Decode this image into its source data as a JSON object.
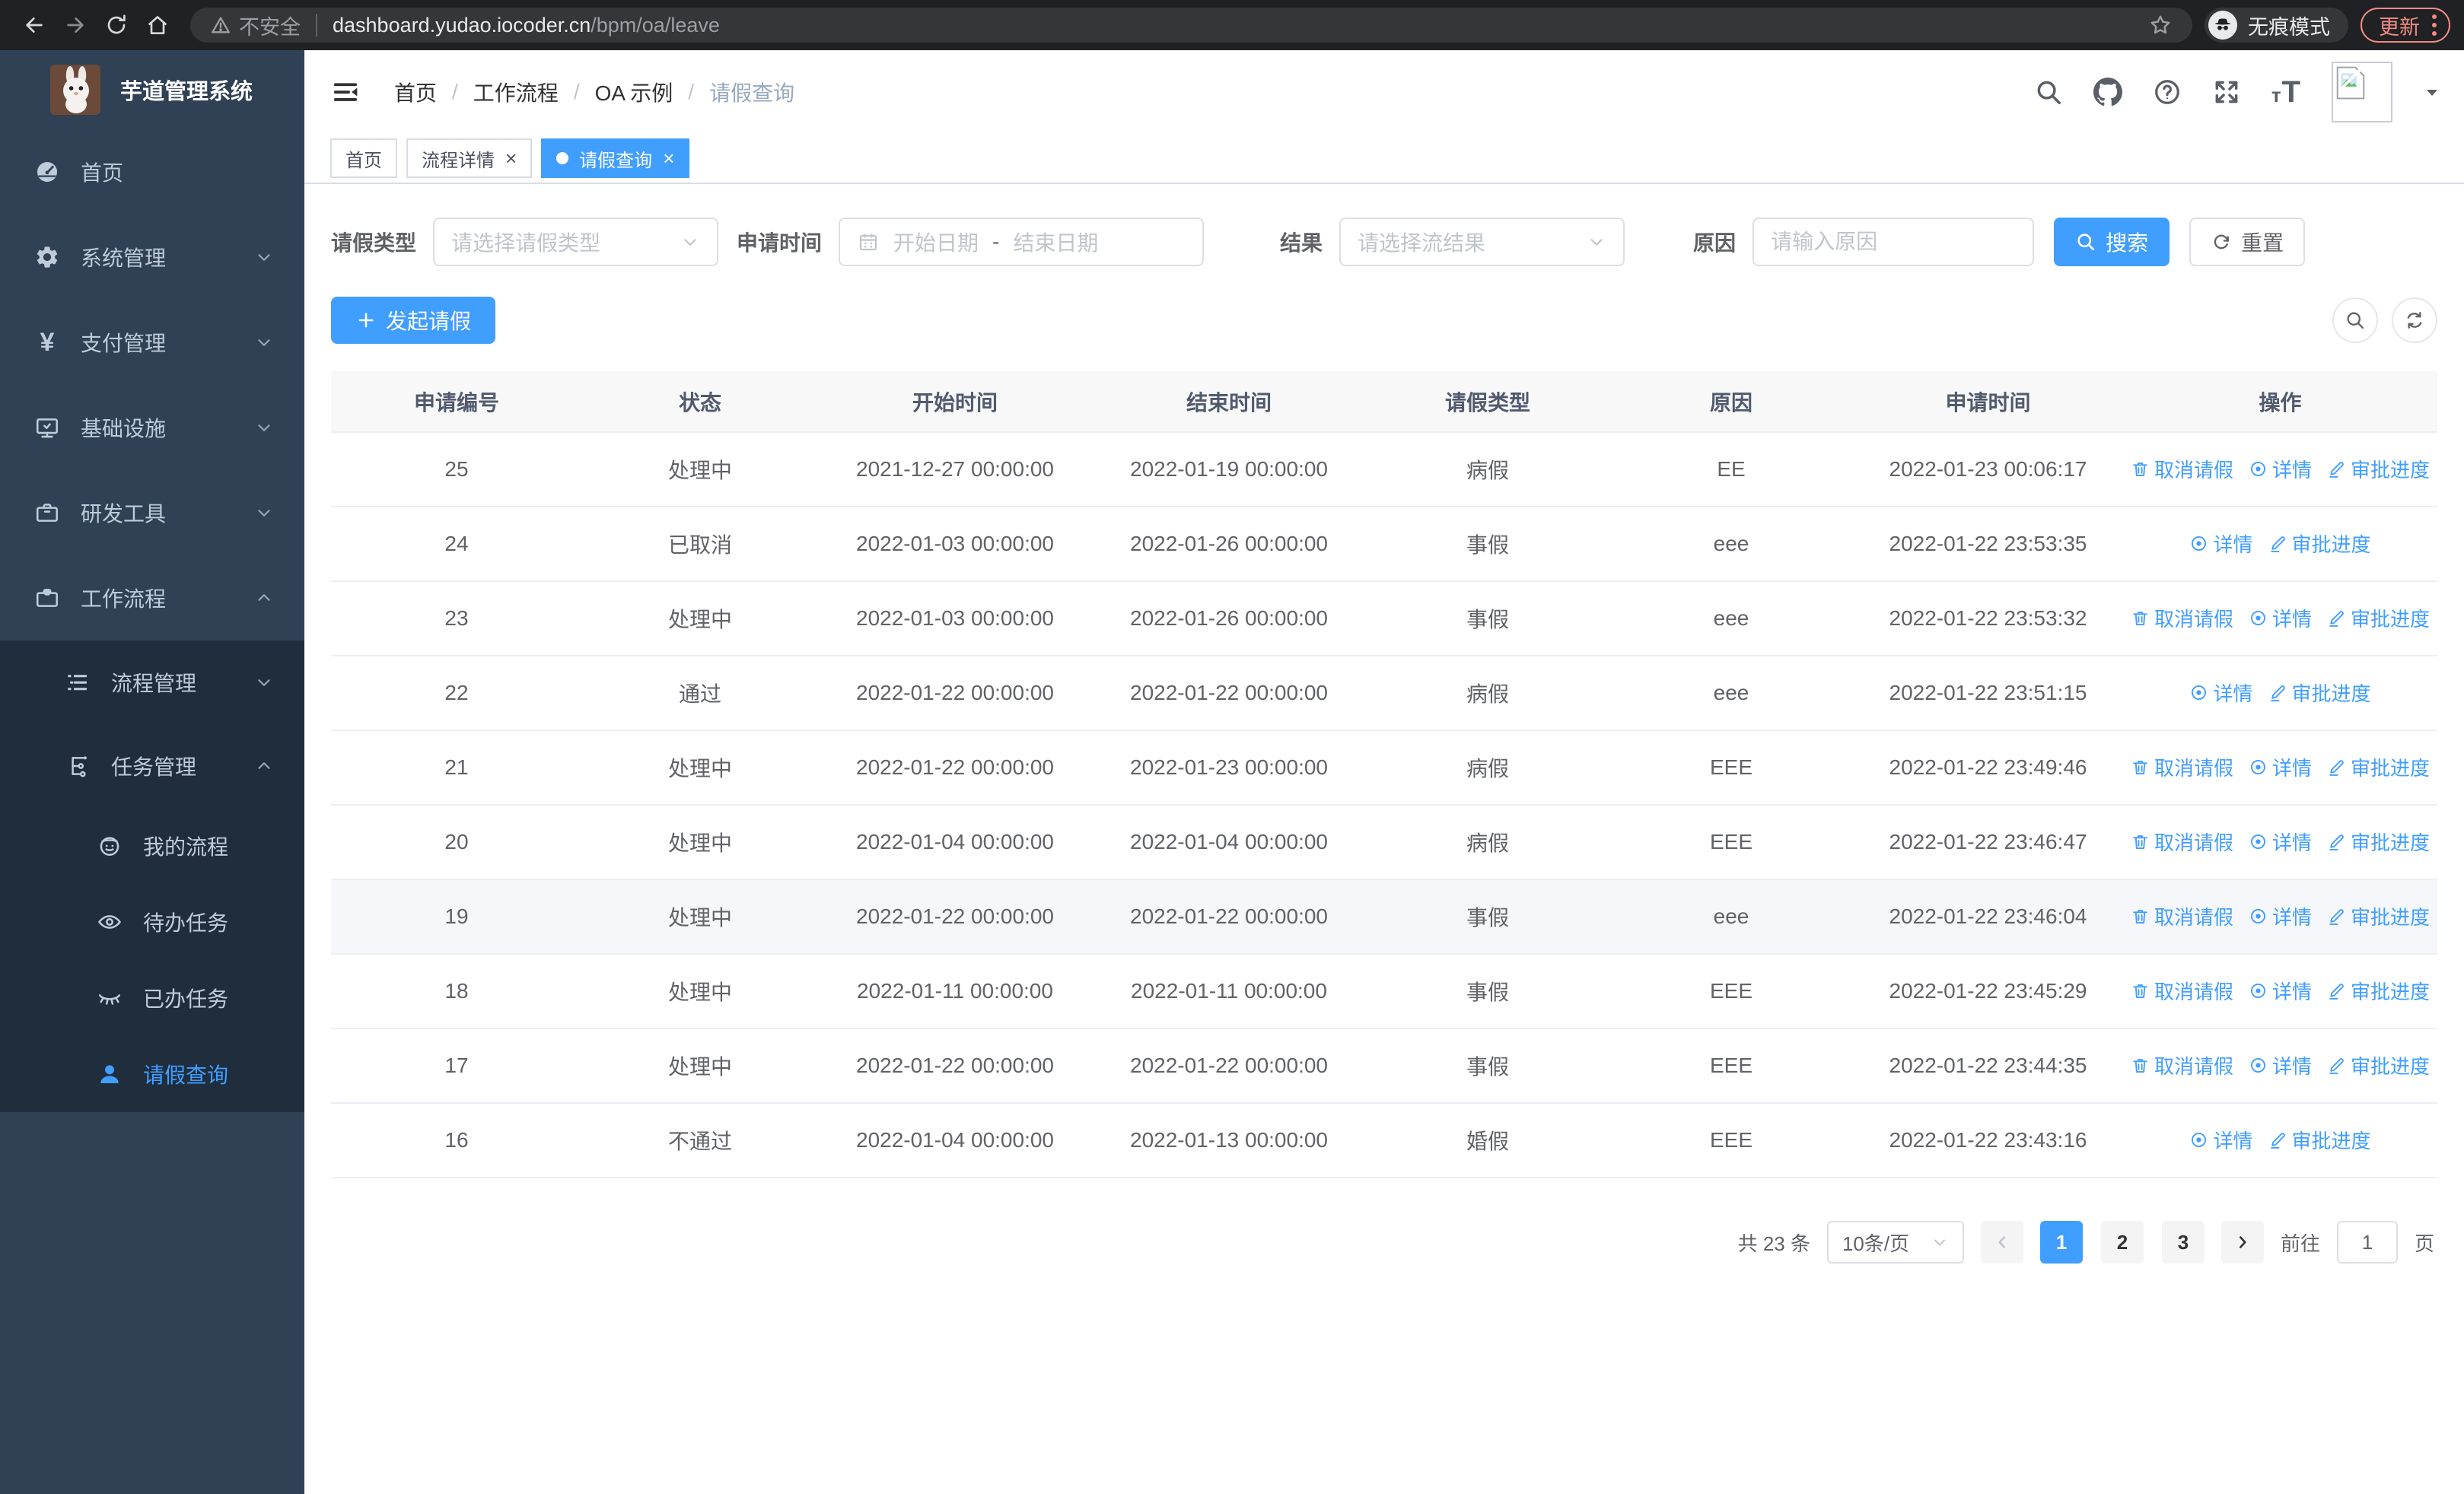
{
  "browser": {
    "not_secure_label": "不安全",
    "url_host": "dashboard.yudao.iocoder.cn",
    "url_path": "/bpm/oa/leave",
    "incognito_label": "无痕模式",
    "update_label": "更新"
  },
  "colors": {
    "accent": "#409eff",
    "sidebar_bg": "#304156",
    "submenu_bg": "#1f2d3d",
    "update_red": "#f28b82",
    "row_highlight": "#f5f7fa"
  },
  "sidebar": {
    "title": "芋道管理系统",
    "items": [
      {
        "key": "home",
        "label": "首页",
        "icon": "dashboard-icon",
        "level": 1
      },
      {
        "key": "system",
        "label": "系统管理",
        "icon": "gear-icon",
        "level": 1,
        "chevron": "down"
      },
      {
        "key": "payment",
        "label": "支付管理",
        "icon": "yen-icon",
        "level": 1,
        "chevron": "down"
      },
      {
        "key": "infrastructure",
        "label": "基础设施",
        "icon": "monitor-icon",
        "level": 1,
        "chevron": "down"
      },
      {
        "key": "dev-tools",
        "label": "研发工具",
        "icon": "toolbox-icon",
        "level": 1,
        "chevron": "down"
      },
      {
        "key": "workflow",
        "label": "工作流程",
        "icon": "briefcase-icon",
        "level": 1,
        "chevron": "up"
      },
      {
        "key": "process-mgmt",
        "label": "流程管理",
        "icon": "list-tree-icon",
        "level": 2,
        "chevron": "down",
        "in_submenu": true
      },
      {
        "key": "task-mgmt",
        "label": "任务管理",
        "icon": "flow-icon",
        "level": 2,
        "chevron": "up",
        "in_submenu": true
      },
      {
        "key": "my-process",
        "label": "我的流程",
        "icon": "robot-icon",
        "level": 3,
        "in_submenu": true
      },
      {
        "key": "todo-tasks",
        "label": "待办任务",
        "icon": "eye-open-icon",
        "level": 3,
        "in_submenu": true
      },
      {
        "key": "done-tasks",
        "label": "已办任务",
        "icon": "eye-closed-icon",
        "level": 3,
        "in_submenu": true
      },
      {
        "key": "leave-query",
        "label": "请假查询",
        "icon": "user-icon",
        "level": 3,
        "in_submenu": true,
        "active": true
      }
    ]
  },
  "header": {
    "breadcrumb": [
      "首页",
      "工作流程",
      "OA 示例",
      "请假查询"
    ]
  },
  "tabs": [
    {
      "key": "home",
      "label": "首页",
      "closable": false,
      "active": false
    },
    {
      "key": "process-detail",
      "label": "流程详情",
      "closable": true,
      "active": false
    },
    {
      "key": "leave-query",
      "label": "请假查询",
      "closable": true,
      "active": true
    }
  ],
  "filters": {
    "leave_type": {
      "label": "请假类型",
      "placeholder": "请选择请假类型"
    },
    "apply_time": {
      "label": "申请时间",
      "start_placeholder": "开始日期",
      "separator": "-",
      "end_placeholder": "结束日期"
    },
    "result": {
      "label": "结果",
      "placeholder": "请选择流结果"
    },
    "reason": {
      "label": "原因",
      "placeholder": "请输入原因"
    },
    "search_label": "搜索",
    "reset_label": "重置"
  },
  "toolbar": {
    "create_label": "发起请假"
  },
  "table": {
    "columns": [
      "申请编号",
      "状态",
      "开始时间",
      "结束时间",
      "请假类型",
      "原因",
      "申请时间",
      "操作"
    ],
    "rows": [
      {
        "id": "25",
        "status": "处理中",
        "start": "2021-12-27 00:00:00",
        "end": "2022-01-19 00:00:00",
        "type": "病假",
        "reason": "EE",
        "applied": "2022-01-23 00:06:17",
        "actions": [
          "取消请假",
          "详情",
          "审批进度"
        ]
      },
      {
        "id": "24",
        "status": "已取消",
        "start": "2022-01-03 00:00:00",
        "end": "2022-01-26 00:00:00",
        "type": "事假",
        "reason": "eee",
        "applied": "2022-01-22 23:53:35",
        "actions": [
          "详情",
          "审批进度"
        ]
      },
      {
        "id": "23",
        "status": "处理中",
        "start": "2022-01-03 00:00:00",
        "end": "2022-01-26 00:00:00",
        "type": "事假",
        "reason": "eee",
        "applied": "2022-01-22 23:53:32",
        "actions": [
          "取消请假",
          "详情",
          "审批进度"
        ]
      },
      {
        "id": "22",
        "status": "通过",
        "start": "2022-01-22 00:00:00",
        "end": "2022-01-22 00:00:00",
        "type": "病假",
        "reason": "eee",
        "applied": "2022-01-22 23:51:15",
        "actions": [
          "详情",
          "审批进度"
        ]
      },
      {
        "id": "21",
        "status": "处理中",
        "start": "2022-01-22 00:00:00",
        "end": "2022-01-23 00:00:00",
        "type": "病假",
        "reason": "EEE",
        "applied": "2022-01-22 23:49:46",
        "actions": [
          "取消请假",
          "详情",
          "审批进度"
        ]
      },
      {
        "id": "20",
        "status": "处理中",
        "start": "2022-01-04 00:00:00",
        "end": "2022-01-04 00:00:00",
        "type": "病假",
        "reason": "EEE",
        "applied": "2022-01-22 23:46:47",
        "actions": [
          "取消请假",
          "详情",
          "审批进度"
        ]
      },
      {
        "id": "19",
        "status": "处理中",
        "start": "2022-01-22 00:00:00",
        "end": "2022-01-22 00:00:00",
        "type": "事假",
        "reason": "eee",
        "applied": "2022-01-22 23:46:04",
        "actions": [
          "取消请假",
          "详情",
          "审批进度"
        ],
        "highlight": true
      },
      {
        "id": "18",
        "status": "处理中",
        "start": "2022-01-11 00:00:00",
        "end": "2022-01-11 00:00:00",
        "type": "事假",
        "reason": "EEE",
        "applied": "2022-01-22 23:45:29",
        "actions": [
          "取消请假",
          "详情",
          "审批进度"
        ]
      },
      {
        "id": "17",
        "status": "处理中",
        "start": "2022-01-22 00:00:00",
        "end": "2022-01-22 00:00:00",
        "type": "事假",
        "reason": "EEE",
        "applied": "2022-01-22 23:44:35",
        "actions": [
          "取消请假",
          "详情",
          "审批进度"
        ]
      },
      {
        "id": "16",
        "status": "不通过",
        "start": "2022-01-04 00:00:00",
        "end": "2022-01-13 00:00:00",
        "type": "婚假",
        "reason": "EEE",
        "applied": "2022-01-22 23:43:16",
        "actions": [
          "详情",
          "审批进度"
        ]
      }
    ]
  },
  "pagination": {
    "total_text": "共 23 条",
    "page_size": "10条/页",
    "pages": [
      "1",
      "2",
      "3"
    ],
    "active_page": "1",
    "goto_label": "前往",
    "goto_value": "1",
    "page_unit": "页"
  }
}
